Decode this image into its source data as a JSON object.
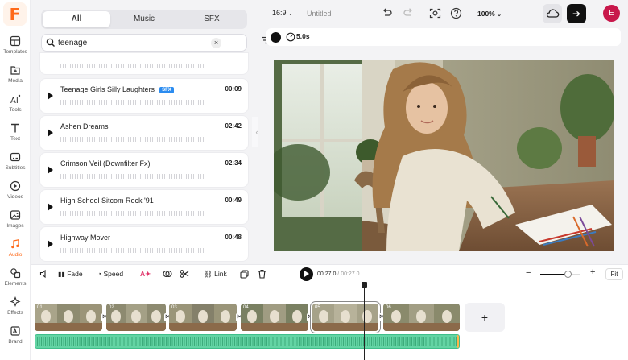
{
  "app": {
    "logo_letter": "F",
    "brand_color": "#ff6a1a"
  },
  "rail": [
    {
      "label": "Templates",
      "icon": "templates-icon"
    },
    {
      "label": "Media",
      "icon": "media-icon"
    },
    {
      "label": "Tools",
      "icon": "ai-tools-icon"
    },
    {
      "label": "Text",
      "icon": "text-icon"
    },
    {
      "label": "Subtitles",
      "icon": "subtitles-icon"
    },
    {
      "label": "Videos",
      "icon": "videos-icon"
    },
    {
      "label": "Images",
      "icon": "images-icon"
    },
    {
      "label": "Audio",
      "icon": "audio-icon"
    },
    {
      "label": "Elements",
      "icon": "elements-icon"
    },
    {
      "label": "Effects",
      "icon": "effects-icon"
    },
    {
      "label": "Brand",
      "icon": "brand-icon"
    }
  ],
  "library": {
    "tabs": [
      "All",
      "Music",
      "SFX"
    ],
    "selected_tab": "All",
    "search": {
      "value": "teenage",
      "placeholder": ""
    },
    "tracks": [
      {
        "title": "Teenage Girls Silly Laughters",
        "badge": "SFX",
        "duration": "00:09"
      },
      {
        "title": "Ashen Dreams",
        "badge": "",
        "duration": "02:42"
      },
      {
        "title": "Crimson Veil (Downfilter Fx)",
        "badge": "",
        "duration": "02:34"
      },
      {
        "title": "High School Sitcom Rock '91",
        "badge": "",
        "duration": "00:49"
      },
      {
        "title": "Highway Mover",
        "badge": "",
        "duration": "00:48"
      }
    ]
  },
  "topbar": {
    "ratio": "16:9",
    "title": "Untitled",
    "zoom": "100%",
    "avatar_letter": "E",
    "avatar_color": "#c8184b"
  },
  "canvas": {
    "bg_color": "#111111",
    "duration": "5.0s"
  },
  "timeline": {
    "tools": {
      "fade": "Fade",
      "speed": "Speed",
      "link": "Link"
    },
    "current_time": "00:27.0",
    "separator": " / ",
    "total_time": "00:27.0",
    "fit_label": "Fit",
    "clip_numbers": [
      "01",
      "02",
      "03",
      "04",
      "05",
      "06"
    ],
    "audio_color": "#63d4a4"
  }
}
